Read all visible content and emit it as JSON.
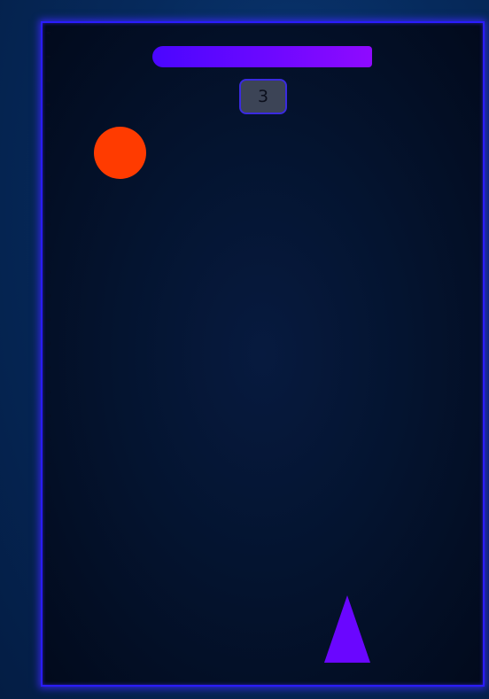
{
  "game": {
    "score": "3",
    "ball_color": "#ff3b00",
    "bar_gradient": [
      "#4a06ff",
      "#8f0aff"
    ],
    "ship_color": "#6a06ff",
    "frame_border_color": "#2a1cff",
    "dash_glyph": "≈"
  }
}
